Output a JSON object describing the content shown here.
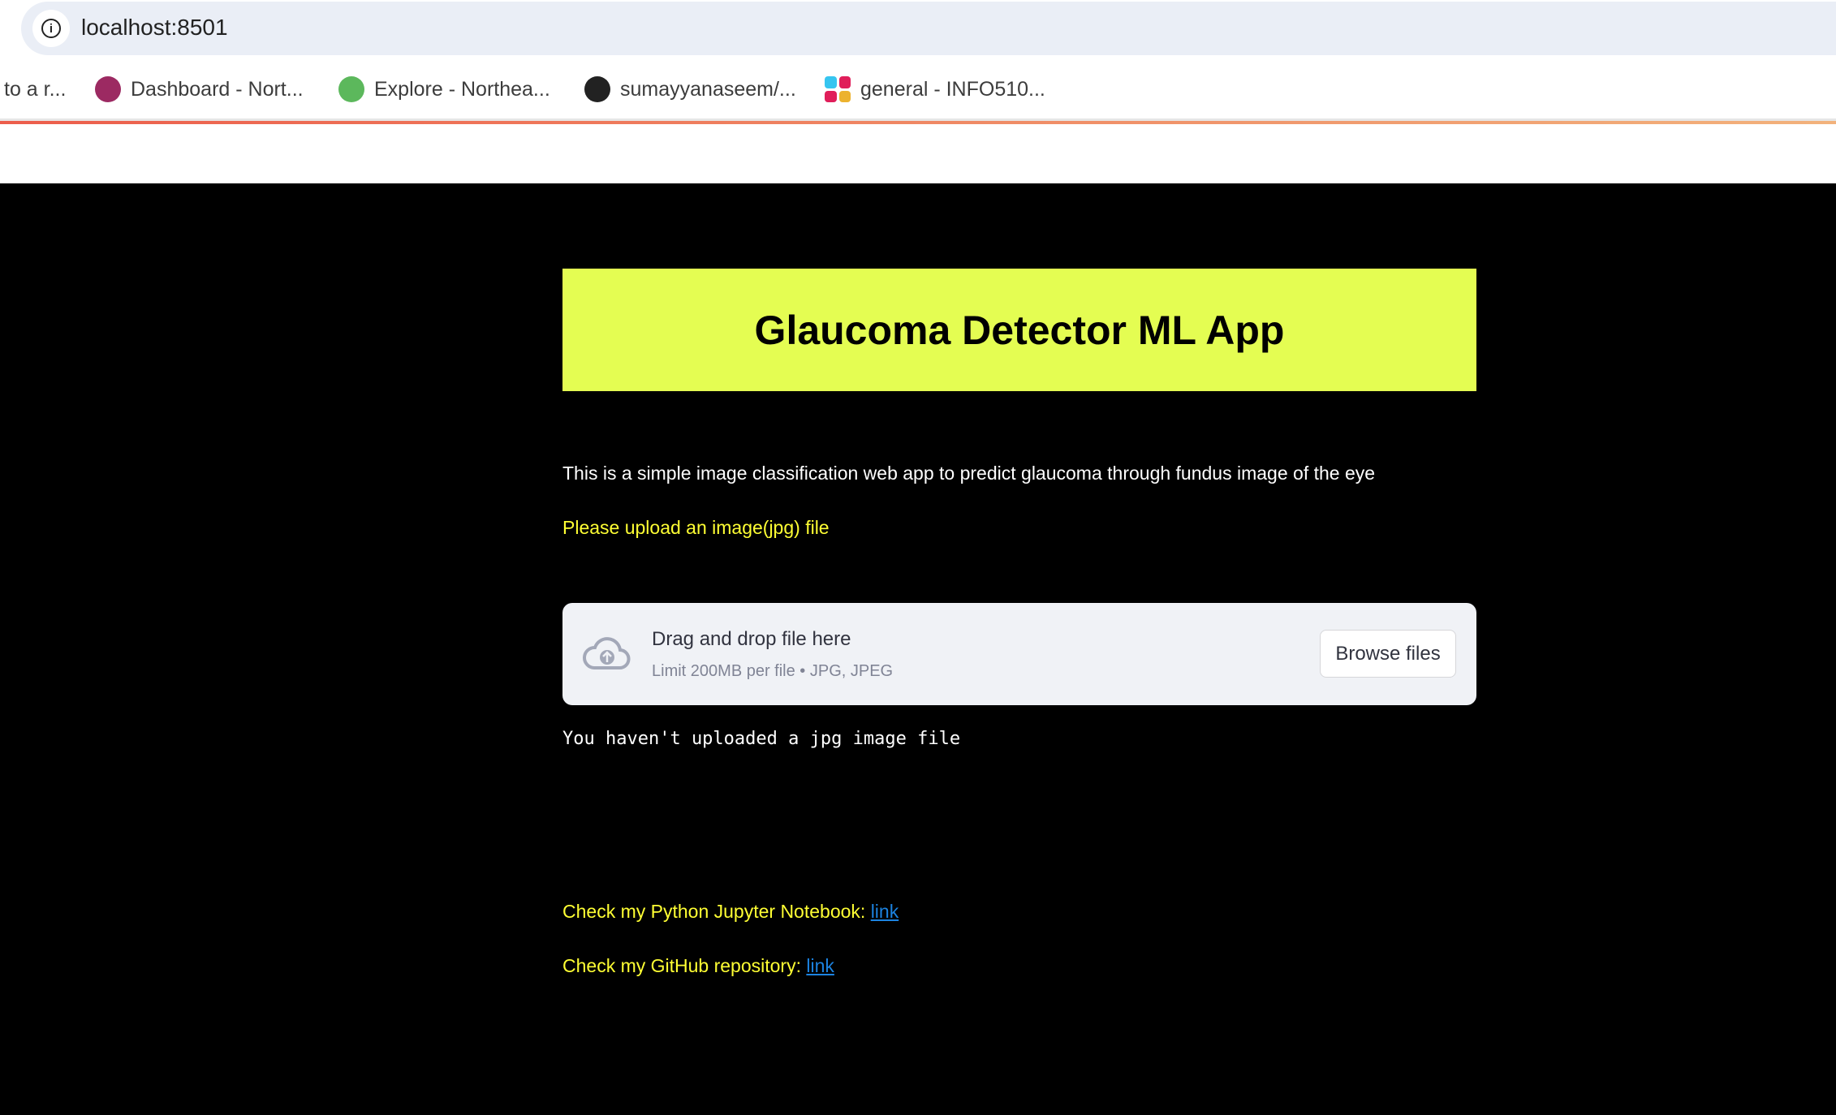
{
  "browser": {
    "url": "localhost:8501",
    "bookmarks": [
      {
        "label": "to a r...",
        "icon": "none"
      },
      {
        "label": "Dashboard - Nort...",
        "icon": "dashboard-icon",
        "color": "#9c2a62"
      },
      {
        "label": "Explore - Northea...",
        "icon": "explore-icon",
        "color": "#5cb85c"
      },
      {
        "label": "sumayyanaseem/...",
        "icon": "github-icon",
        "color": "#222222"
      },
      {
        "label": "general - INFO510...",
        "icon": "slack-icon",
        "color": "#e01e5a"
      }
    ]
  },
  "app": {
    "title": "Glaucoma Detector ML App",
    "title_bg": "#e4fd52",
    "description": "This is a simple image classification web app to predict glaucoma through fundus image of the eye",
    "upload_prompt": "Please upload an image(jpg) file",
    "accent_yellow": "#ffff33",
    "uploader": {
      "drag_text": "Drag and drop file here",
      "limit_text": "Limit 200MB per file • JPG, JPEG",
      "browse_label": "Browse files"
    },
    "status_message": "You haven't uploaded a jpg image file",
    "notebook": {
      "label": "Check my Python Jupyter Notebook: ",
      "link": "link"
    },
    "github": {
      "label": "Check my GitHub repository: ",
      "link": "link"
    }
  }
}
